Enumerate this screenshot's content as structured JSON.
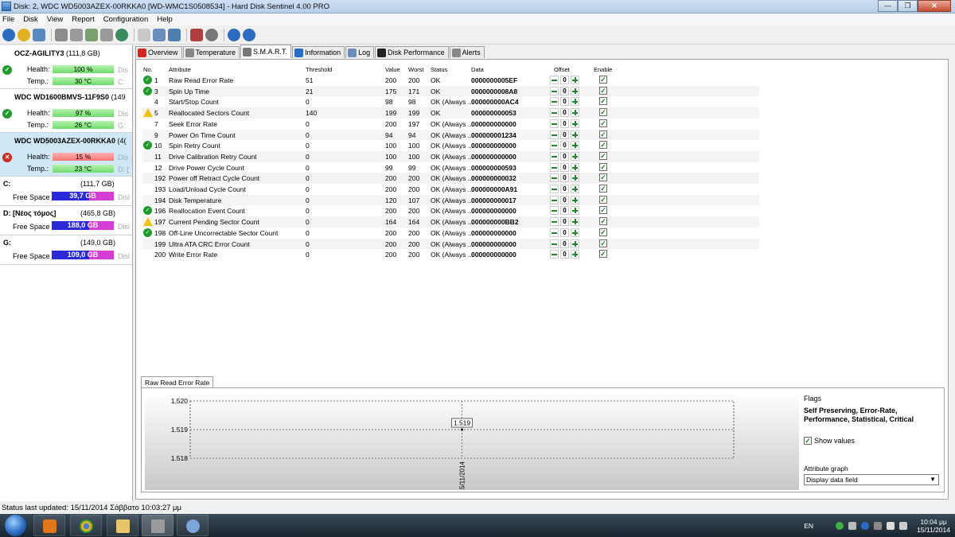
{
  "window": {
    "title": "Disk: 2, WDC WD5003AZEX-00RKKA0 [WD-WMC1S0508534]  -  Hard Disk Sentinel 4.00 PRO",
    "minimize": "—",
    "maximize": "❐",
    "close": "✕"
  },
  "menu": [
    "File",
    "Disk",
    "View",
    "Report",
    "Configuration",
    "Help"
  ],
  "disks": [
    {
      "name": "OCZ-AGILITY3",
      "size": "(111,8 GB)",
      "health_label": "Health:",
      "health": "100 %",
      "health_pct": 100,
      "temp_label": "Temp.:",
      "temp": "30 °C",
      "drive": "C:",
      "status": "ok"
    },
    {
      "name": "WDC WD1600BMVS-11F9S0",
      "size": "(149",
      "health_label": "Health:",
      "health": "97 %",
      "health_pct": 97,
      "temp_label": "Temp.:",
      "temp": "26 °C",
      "drive": "G:",
      "status": "ok"
    },
    {
      "name": "WDC WD5003AZEX-00RKKA0",
      "size": "(4(",
      "health_label": "Health:",
      "health": "15 %",
      "health_pct": 15,
      "temp_label": "Temp.:",
      "temp": "23 °C",
      "drive": "D: [",
      "status": "bad"
    }
  ],
  "partitions": [
    {
      "name": "C:",
      "size": "(111,7 GB)",
      "free_label": "Free Space",
      "free": "39,7 GB",
      "dis": "Disl"
    },
    {
      "name": "D: [Νέος τόμος]",
      "size": "(465,8 GB)",
      "free_label": "Free Space",
      "free": "188,0 GB",
      "dis": "Disl"
    },
    {
      "name": "G:",
      "size": "(149,0 GB)",
      "free_label": "Free Space",
      "free": "109,0 GB",
      "dis": "Disl"
    }
  ],
  "tabs": [
    {
      "label": "Overview",
      "active": false,
      "icon_color": "#d4271f"
    },
    {
      "label": "Temperature",
      "active": false,
      "icon_color": "#888888"
    },
    {
      "label": "S.M.A.R.T.",
      "active": true,
      "icon_color": "#777777"
    },
    {
      "label": "Information",
      "active": false,
      "icon_color": "#2b6cc2"
    },
    {
      "label": "Log",
      "active": false,
      "icon_color": "#6a8fbf"
    },
    {
      "label": "Disk Performance",
      "active": false,
      "icon_color": "#222222"
    },
    {
      "label": "Alerts",
      "active": false,
      "icon_color": "#8a8a8a"
    }
  ],
  "smart_headers": {
    "no": "No.",
    "attribute": "Attribute",
    "threshold": "Threshold",
    "value": "Value",
    "worst": "Worst",
    "status": "Status",
    "data": "Data",
    "offset": "Offset",
    "enable": "Enable"
  },
  "smart_rows": [
    {
      "no": "1",
      "attribute": "Raw Read Error Rate",
      "threshold": "51",
      "value": "200",
      "worst": "200",
      "status": "OK",
      "data": "0000000005EF",
      "offset": "0",
      "icon": "ok"
    },
    {
      "no": "3",
      "attribute": "Spin Up Time",
      "threshold": "21",
      "value": "175",
      "worst": "171",
      "status": "OK",
      "data": "0000000008A8",
      "offset": "0",
      "icon": "ok"
    },
    {
      "no": "4",
      "attribute": "Start/Stop Count",
      "threshold": "0",
      "value": "98",
      "worst": "98",
      "status": "OK (Always ...",
      "data": "000000000AC4",
      "offset": "0",
      "icon": ""
    },
    {
      "no": "5",
      "attribute": "Reallocated Sectors Count",
      "threshold": "140",
      "value": "199",
      "worst": "199",
      "status": "OK",
      "data": "000000000053",
      "offset": "0",
      "icon": "warn"
    },
    {
      "no": "7",
      "attribute": "Seek Error Rate",
      "threshold": "0",
      "value": "200",
      "worst": "197",
      "status": "OK (Always ...",
      "data": "000000000000",
      "offset": "0",
      "icon": ""
    },
    {
      "no": "9",
      "attribute": "Power On Time Count",
      "threshold": "0",
      "value": "94",
      "worst": "94",
      "status": "OK (Always ...",
      "data": "000000001234",
      "offset": "0",
      "icon": ""
    },
    {
      "no": "10",
      "attribute": "Spin Retry Count",
      "threshold": "0",
      "value": "100",
      "worst": "100",
      "status": "OK (Always ...",
      "data": "000000000000",
      "offset": "0",
      "icon": "ok"
    },
    {
      "no": "11",
      "attribute": "Drive Calibration Retry Count",
      "threshold": "0",
      "value": "100",
      "worst": "100",
      "status": "OK (Always ...",
      "data": "000000000000",
      "offset": "0",
      "icon": ""
    },
    {
      "no": "12",
      "attribute": "Drive Power Cycle Count",
      "threshold": "0",
      "value": "99",
      "worst": "99",
      "status": "OK (Always ...",
      "data": "000000000593",
      "offset": "0",
      "icon": ""
    },
    {
      "no": "192",
      "attribute": "Power off Retract Cycle Count",
      "threshold": "0",
      "value": "200",
      "worst": "200",
      "status": "OK (Always ...",
      "data": "000000000032",
      "offset": "0",
      "icon": ""
    },
    {
      "no": "193",
      "attribute": "Load/Unload Cycle Count",
      "threshold": "0",
      "value": "200",
      "worst": "200",
      "status": "OK (Always ...",
      "data": "000000000A91",
      "offset": "0",
      "icon": ""
    },
    {
      "no": "194",
      "attribute": "Disk Temperature",
      "threshold": "0",
      "value": "120",
      "worst": "107",
      "status": "OK (Always ...",
      "data": "000000000017",
      "offset": "0",
      "icon": ""
    },
    {
      "no": "196",
      "attribute": "Reallocation Event Count",
      "threshold": "0",
      "value": "200",
      "worst": "200",
      "status": "OK (Always ...",
      "data": "000000000000",
      "offset": "0",
      "icon": "ok"
    },
    {
      "no": "197",
      "attribute": "Current Pending Sector Count",
      "threshold": "0",
      "value": "164",
      "worst": "164",
      "status": "OK (Always ...",
      "data": "000000000BB2",
      "offset": "0",
      "icon": "warn"
    },
    {
      "no": "198",
      "attribute": "Off-Line Uncorrectable Sector Count",
      "threshold": "0",
      "value": "200",
      "worst": "200",
      "status": "OK (Always ...",
      "data": "000000000000",
      "offset": "0",
      "icon": "ok"
    },
    {
      "no": "199",
      "attribute": "Ultra ATA CRC Error Count",
      "threshold": "0",
      "value": "200",
      "worst": "200",
      "status": "OK (Always ...",
      "data": "000000000000",
      "offset": "0",
      "icon": ""
    },
    {
      "no": "200",
      "attribute": "Write Error Rate",
      "threshold": "0",
      "value": "200",
      "worst": "200",
      "status": "OK (Always ...",
      "data": "000000000000",
      "offset": "0",
      "icon": ""
    }
  ],
  "graph": {
    "tab_label": "Raw Read Error Rate",
    "flags_label": "Flags",
    "flags_value": "Self Preserving, Error-Rate, Performance, Statistical, Critical",
    "show_values_label": "Show values",
    "show_values_checked": true,
    "attr_graph_label": "Attribute graph",
    "attr_graph_value": "Display data field"
  },
  "chart_data": {
    "type": "line",
    "x": [
      "15/11/2014"
    ],
    "series": [
      {
        "values": [
          1.519
        ]
      }
    ],
    "yticks": [
      "1.520",
      "1.519",
      "1.518"
    ],
    "ylim": [
      1.518,
      1.52
    ],
    "point_label": "1.519",
    "grid": true
  },
  "status_bar": "Status last updated: 15/11/2014 Σάββατο 10:03:27 μμ",
  "taskbar": {
    "lang": "EN",
    "time": "10:04 μμ",
    "date": "15/11/2014"
  }
}
